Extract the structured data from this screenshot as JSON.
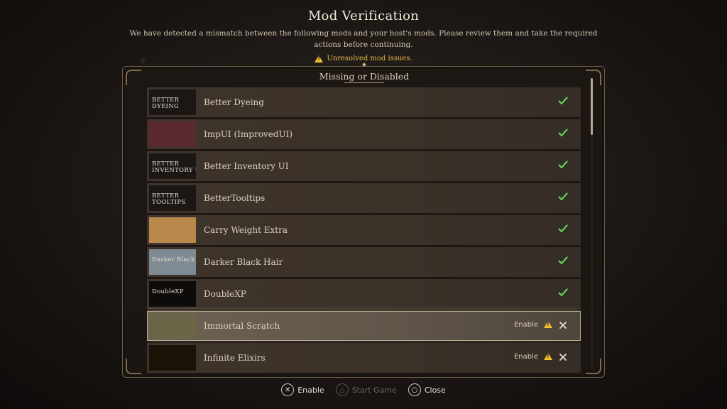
{
  "header": {
    "title": "Mod Verification",
    "description": "We have detected a mismatch between the following mods and your host's mods. Please review them and take the required actions before continuing.",
    "warning": "Unresolved mod issues."
  },
  "panel": {
    "section_title": "Missing or Disabled"
  },
  "mods": [
    {
      "name": "Better Dyeing",
      "thumb_text": "BETTER\nDYEING",
      "status": "ok",
      "thumb_bg": "#1a1714"
    },
    {
      "name": "ImpUI (ImprovedUI)",
      "thumb_text": "",
      "status": "ok",
      "thumb_bg": "#5a2a30"
    },
    {
      "name": "Better Inventory UI",
      "thumb_text": "BETTER\nINVENTORY UI",
      "status": "ok",
      "thumb_bg": "#1a1714"
    },
    {
      "name": "BetterTooltips",
      "thumb_text": "BETTER\nTOOLTIPS",
      "status": "ok",
      "thumb_bg": "#1a1714"
    },
    {
      "name": "Carry Weight Extra",
      "thumb_text": "",
      "status": "ok",
      "thumb_bg": "#b8894a"
    },
    {
      "name": "Darker Black Hair",
      "thumb_text": "Darker Black Hair",
      "status": "ok",
      "thumb_bg": "#7f8a92"
    },
    {
      "name": "DoubleXP",
      "thumb_text": "DoubleXP",
      "status": "ok",
      "thumb_bg": "#0e0c0b"
    },
    {
      "name": "Immortal Scratch",
      "thumb_text": "",
      "status": "issue",
      "action": "Enable",
      "thumb_bg": "#6b6548"
    },
    {
      "name": "Infinite Elixirs",
      "thumb_text": "",
      "status": "issue",
      "action": "Enable",
      "thumb_bg": "#1a1408"
    }
  ],
  "footer": {
    "enable_label": "Enable",
    "start_label": "Start Game",
    "close_label": "Close"
  },
  "colors": {
    "accent_gold": "#e6b64a",
    "check_green": "#5fd24e"
  }
}
